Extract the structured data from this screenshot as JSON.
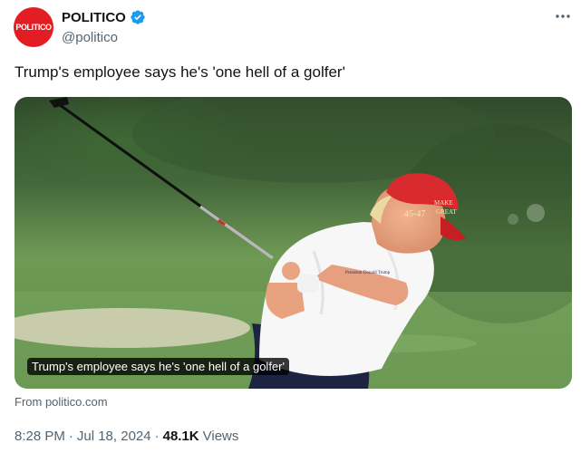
{
  "author": {
    "avatar_text": "POLITICO",
    "display_name": "POLITICO",
    "handle": "@politico",
    "verified": true,
    "brand_color": "#e21d23",
    "verified_color": "#1d9bf0"
  },
  "tweet": {
    "text": "Trump's employee says he's 'one hell of a golfer'"
  },
  "card": {
    "caption": "Trump's employee says he's 'one hell of a golfer'",
    "source": "From politico.com",
    "image_description_icon": "golf-photo",
    "hat_text": "45-47",
    "hat_text_2": "MAKE",
    "hat_text_3": "GREAT",
    "shirt_text": "President Donald Trump"
  },
  "meta": {
    "time": "8:28 PM",
    "separator": "·",
    "date": "Jul 18, 2024",
    "separator_2": "·",
    "views_count": "48.1K",
    "views_label": "Views"
  },
  "icons": {
    "more": "more-icon",
    "verified": "verified-badge-icon"
  }
}
